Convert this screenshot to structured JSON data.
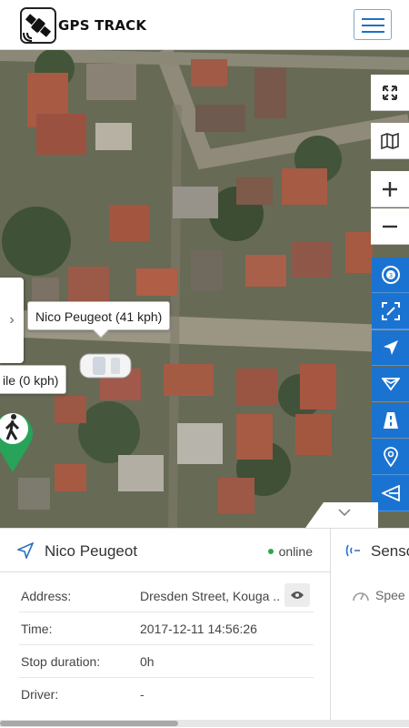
{
  "app": {
    "title": "GPS TRACK"
  },
  "map": {
    "tooltips": {
      "main": "Nico Peugeot (41 kph)",
      "second": "ile (0 kph)"
    }
  },
  "device_panel": {
    "name": "Nico Peugeot",
    "status": "online",
    "rows": [
      {
        "label": "Address:",
        "value": "Dresden Street, Kouga ..."
      },
      {
        "label": "Time:",
        "value": "2017-12-11 14:56:26"
      },
      {
        "label": "Stop duration:",
        "value": "0h"
      },
      {
        "label": "Driver:",
        "value": "-"
      }
    ]
  },
  "sensors_panel": {
    "title": "Senso",
    "first_item": "Spee"
  },
  "icons": {
    "fullscreen": "expand-icon",
    "map_layers": "map-icon",
    "zoom_in": "plus-icon",
    "zoom_out": "minus-icon",
    "tools": [
      "speed-limit-icon",
      "crop-icon",
      "navigation-arrow-icon",
      "route-icon",
      "traffic-icon",
      "location-pin-icon",
      "send-icon"
    ]
  },
  "colors": {
    "brand_blue": "#1b73d1",
    "online_green": "#2ea84a",
    "marker_green": "#27a35a"
  }
}
